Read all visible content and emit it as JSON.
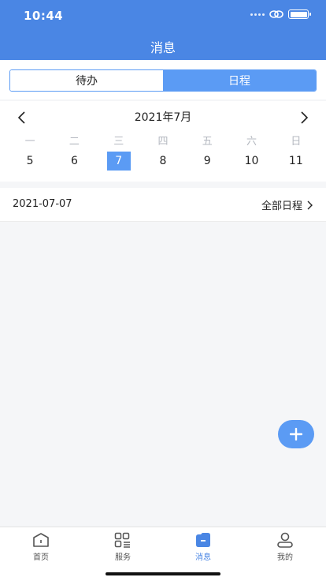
{
  "status_bar": {
    "time": "10:44"
  },
  "header": {
    "title": "消息"
  },
  "segment": {
    "tabs": [
      {
        "label": "待办",
        "active": false
      },
      {
        "label": "日程",
        "active": true
      }
    ]
  },
  "calendar": {
    "month_label": "2021年7月",
    "weekdays": [
      "一",
      "二",
      "三",
      "四",
      "五",
      "六",
      "日"
    ],
    "days": [
      "5",
      "6",
      "7",
      "8",
      "9",
      "10",
      "11"
    ],
    "selected_day": "7"
  },
  "schedule": {
    "date": "2021-07-07",
    "all_label": "全部日程"
  },
  "fab": {
    "icon": "plus-icon"
  },
  "tabbar": {
    "items": [
      {
        "label": "首页",
        "icon": "home-icon",
        "active": false
      },
      {
        "label": "服务",
        "icon": "grid-icon",
        "active": false
      },
      {
        "label": "消息",
        "icon": "message-icon",
        "active": true
      },
      {
        "label": "我的",
        "icon": "user-icon",
        "active": false
      }
    ]
  },
  "colors": {
    "brand": "#4a86e4",
    "accent": "#5b9bf4"
  }
}
